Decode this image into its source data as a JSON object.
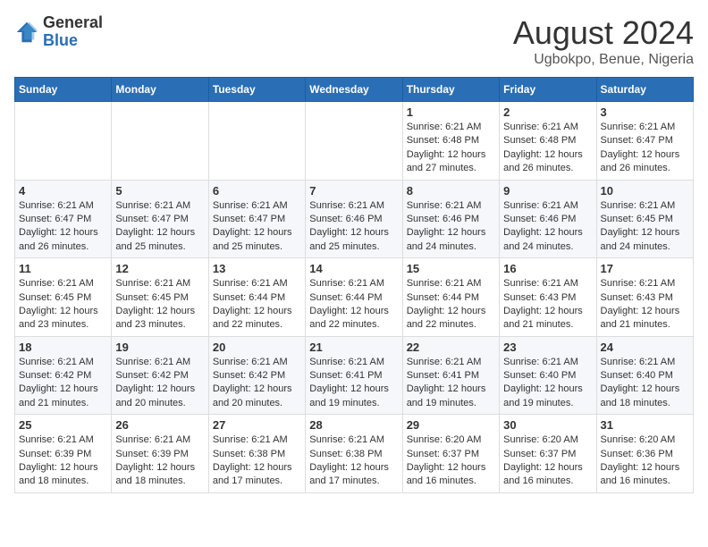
{
  "header": {
    "logo_general": "General",
    "logo_blue": "Blue",
    "month_year": "August 2024",
    "location": "Ugbokpo, Benue, Nigeria"
  },
  "weekdays": [
    "Sunday",
    "Monday",
    "Tuesday",
    "Wednesday",
    "Thursday",
    "Friday",
    "Saturday"
  ],
  "weeks": [
    [
      {
        "day": "",
        "info": ""
      },
      {
        "day": "",
        "info": ""
      },
      {
        "day": "",
        "info": ""
      },
      {
        "day": "",
        "info": ""
      },
      {
        "day": "1",
        "info": "Sunrise: 6:21 AM\nSunset: 6:48 PM\nDaylight: 12 hours and 27 minutes."
      },
      {
        "day": "2",
        "info": "Sunrise: 6:21 AM\nSunset: 6:48 PM\nDaylight: 12 hours and 26 minutes."
      },
      {
        "day": "3",
        "info": "Sunrise: 6:21 AM\nSunset: 6:47 PM\nDaylight: 12 hours and 26 minutes."
      }
    ],
    [
      {
        "day": "4",
        "info": "Sunrise: 6:21 AM\nSunset: 6:47 PM\nDaylight: 12 hours and 26 minutes."
      },
      {
        "day": "5",
        "info": "Sunrise: 6:21 AM\nSunset: 6:47 PM\nDaylight: 12 hours and 25 minutes."
      },
      {
        "day": "6",
        "info": "Sunrise: 6:21 AM\nSunset: 6:47 PM\nDaylight: 12 hours and 25 minutes."
      },
      {
        "day": "7",
        "info": "Sunrise: 6:21 AM\nSunset: 6:46 PM\nDaylight: 12 hours and 25 minutes."
      },
      {
        "day": "8",
        "info": "Sunrise: 6:21 AM\nSunset: 6:46 PM\nDaylight: 12 hours and 24 minutes."
      },
      {
        "day": "9",
        "info": "Sunrise: 6:21 AM\nSunset: 6:46 PM\nDaylight: 12 hours and 24 minutes."
      },
      {
        "day": "10",
        "info": "Sunrise: 6:21 AM\nSunset: 6:45 PM\nDaylight: 12 hours and 24 minutes."
      }
    ],
    [
      {
        "day": "11",
        "info": "Sunrise: 6:21 AM\nSunset: 6:45 PM\nDaylight: 12 hours and 23 minutes."
      },
      {
        "day": "12",
        "info": "Sunrise: 6:21 AM\nSunset: 6:45 PM\nDaylight: 12 hours and 23 minutes."
      },
      {
        "day": "13",
        "info": "Sunrise: 6:21 AM\nSunset: 6:44 PM\nDaylight: 12 hours and 22 minutes."
      },
      {
        "day": "14",
        "info": "Sunrise: 6:21 AM\nSunset: 6:44 PM\nDaylight: 12 hours and 22 minutes."
      },
      {
        "day": "15",
        "info": "Sunrise: 6:21 AM\nSunset: 6:44 PM\nDaylight: 12 hours and 22 minutes."
      },
      {
        "day": "16",
        "info": "Sunrise: 6:21 AM\nSunset: 6:43 PM\nDaylight: 12 hours and 21 minutes."
      },
      {
        "day": "17",
        "info": "Sunrise: 6:21 AM\nSunset: 6:43 PM\nDaylight: 12 hours and 21 minutes."
      }
    ],
    [
      {
        "day": "18",
        "info": "Sunrise: 6:21 AM\nSunset: 6:42 PM\nDaylight: 12 hours and 21 minutes."
      },
      {
        "day": "19",
        "info": "Sunrise: 6:21 AM\nSunset: 6:42 PM\nDaylight: 12 hours and 20 minutes."
      },
      {
        "day": "20",
        "info": "Sunrise: 6:21 AM\nSunset: 6:42 PM\nDaylight: 12 hours and 20 minutes."
      },
      {
        "day": "21",
        "info": "Sunrise: 6:21 AM\nSunset: 6:41 PM\nDaylight: 12 hours and 19 minutes."
      },
      {
        "day": "22",
        "info": "Sunrise: 6:21 AM\nSunset: 6:41 PM\nDaylight: 12 hours and 19 minutes."
      },
      {
        "day": "23",
        "info": "Sunrise: 6:21 AM\nSunset: 6:40 PM\nDaylight: 12 hours and 19 minutes."
      },
      {
        "day": "24",
        "info": "Sunrise: 6:21 AM\nSunset: 6:40 PM\nDaylight: 12 hours and 18 minutes."
      }
    ],
    [
      {
        "day": "25",
        "info": "Sunrise: 6:21 AM\nSunset: 6:39 PM\nDaylight: 12 hours and 18 minutes."
      },
      {
        "day": "26",
        "info": "Sunrise: 6:21 AM\nSunset: 6:39 PM\nDaylight: 12 hours and 18 minutes."
      },
      {
        "day": "27",
        "info": "Sunrise: 6:21 AM\nSunset: 6:38 PM\nDaylight: 12 hours and 17 minutes."
      },
      {
        "day": "28",
        "info": "Sunrise: 6:21 AM\nSunset: 6:38 PM\nDaylight: 12 hours and 17 minutes."
      },
      {
        "day": "29",
        "info": "Sunrise: 6:20 AM\nSunset: 6:37 PM\nDaylight: 12 hours and 16 minutes."
      },
      {
        "day": "30",
        "info": "Sunrise: 6:20 AM\nSunset: 6:37 PM\nDaylight: 12 hours and 16 minutes."
      },
      {
        "day": "31",
        "info": "Sunrise: 6:20 AM\nSunset: 6:36 PM\nDaylight: 12 hours and 16 minutes."
      }
    ]
  ]
}
